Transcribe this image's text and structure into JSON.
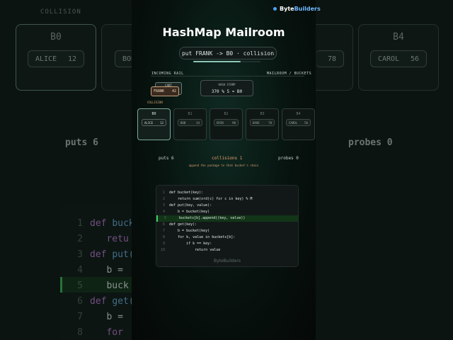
{
  "brand": {
    "prefix": "Byte",
    "suffix": "Builders",
    "accent": "#4aa3ff"
  },
  "title": "HashMap Mailroom",
  "status_text": "put FRANK -> B0 · collision",
  "progress": 0.7,
  "rail": {
    "left_label": "INCOMING RAIL",
    "right_label": "MAILROOM / BUCKETS"
  },
  "cart_label": "CART",
  "package": {
    "name": "FRANK",
    "value": "42"
  },
  "collision_tag": "COLLISION",
  "hash_stamp": {
    "title": "HASH STAMP",
    "expr": "370 % 5 = B0"
  },
  "buckets": [
    {
      "name": "B0",
      "entry_name": "ALICE",
      "entry_value": "12",
      "active": true
    },
    {
      "name": "B1",
      "entry_name": "BOB",
      "entry_value": "34",
      "active": false
    },
    {
      "name": "B2",
      "entry_name": "ERIN",
      "entry_value": "90",
      "active": false
    },
    {
      "name": "B3",
      "entry_name": "DAVE",
      "entry_value": "78",
      "active": false
    },
    {
      "name": "B4",
      "entry_name": "CAROL",
      "entry_value": "56",
      "active": false
    }
  ],
  "stats": {
    "puts": "puts 6",
    "collisions": "collisions 1",
    "probes": "probes 0"
  },
  "hint": "append the package to that bucket's chain",
  "code": {
    "lines": [
      {
        "n": "1",
        "text": "def bucket(key):"
      },
      {
        "n": "2",
        "text": "    return sum(ord(c) for c in key) % M"
      },
      {
        "n": "3",
        "text": "def put(key, value):"
      },
      {
        "n": "4",
        "text": "    b = bucket(key)"
      },
      {
        "n": "5",
        "text": "    buckets[b].append((key, value))",
        "highlight": true
      },
      {
        "n": "6",
        "text": "def get(key):"
      },
      {
        "n": "7",
        "text": "    b = bucket(key)"
      },
      {
        "n": "8",
        "text": "    for k, value in buckets[b]:"
      },
      {
        "n": "9",
        "text": "        if k == key:"
      },
      {
        "n": "10",
        "text": "            return value"
      }
    ],
    "footer": "ByteBuilders"
  },
  "background": {
    "collision_label": "COLLISION",
    "b0": "B0",
    "b4": "B4",
    "alice_name": "ALICE",
    "alice_value": "12",
    "bob_name": "BOB",
    "value_78": "78",
    "carol_name": "CAROL",
    "carol_value": "56",
    "puts": "puts 6",
    "probes": "probes 0",
    "code_lines": [
      {
        "n": "1",
        "kw": "def",
        "rest": "buck"
      },
      {
        "n": "2",
        "kw": "",
        "rest": "retu"
      },
      {
        "n": "3",
        "kw": "def",
        "rest": "put("
      },
      {
        "n": "4",
        "kw": "",
        "rest": "b ="
      },
      {
        "n": "5",
        "kw": "",
        "rest": "buck"
      },
      {
        "n": "6",
        "kw": "def",
        "rest": "get("
      },
      {
        "n": "7",
        "kw": "",
        "rest": "b ="
      },
      {
        "n": "8",
        "kw": "",
        "rest": "for"
      }
    ]
  }
}
